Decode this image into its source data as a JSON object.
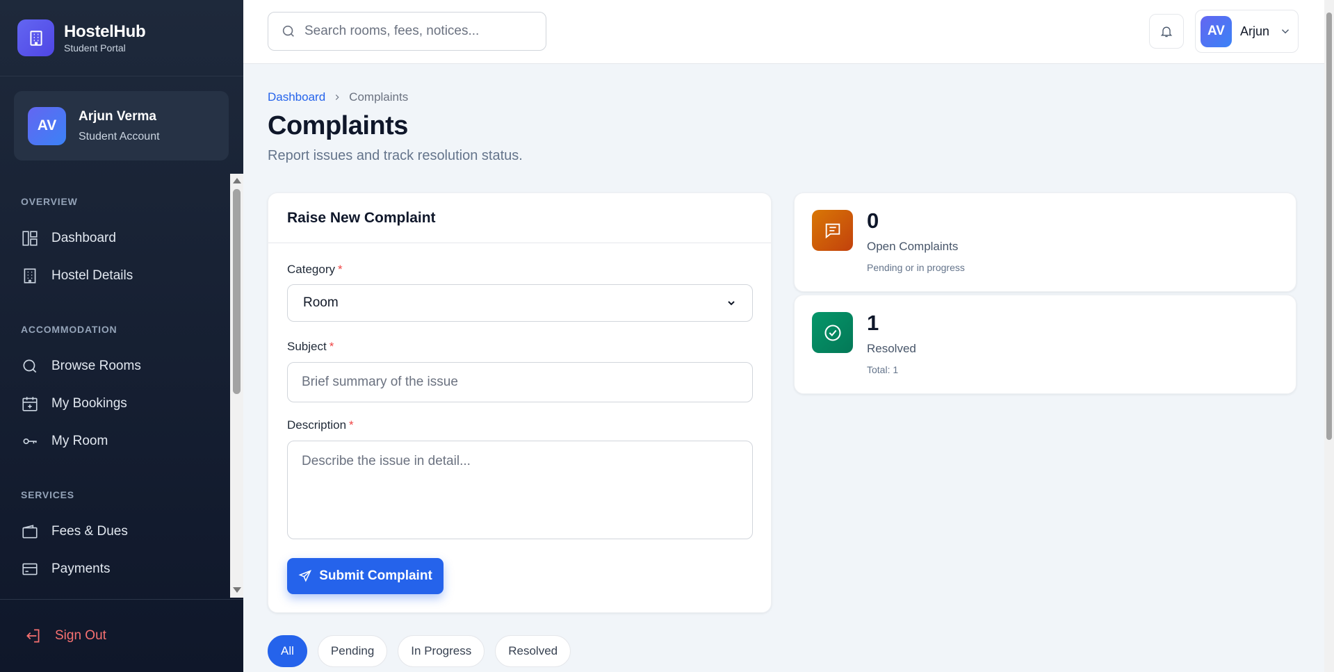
{
  "brand": {
    "name": "HostelHub",
    "subtitle": "Student Portal"
  },
  "user": {
    "initials": "AV",
    "name": "Arjun Verma",
    "role": "Student Account",
    "short_name": "Arjun"
  },
  "nav": {
    "sections": [
      {
        "title": "OVERVIEW",
        "items": [
          {
            "label": "Dashboard",
            "icon": "dashboard-icon"
          },
          {
            "label": "Hostel Details",
            "icon": "building-icon"
          }
        ]
      },
      {
        "title": "ACCOMMODATION",
        "items": [
          {
            "label": "Browse Rooms",
            "icon": "search-icon"
          },
          {
            "label": "My Bookings",
            "icon": "calendar-plus-icon"
          },
          {
            "label": "My Room",
            "icon": "key-icon"
          }
        ]
      },
      {
        "title": "SERVICES",
        "items": [
          {
            "label": "Fees & Dues",
            "icon": "wallet-icon"
          },
          {
            "label": "Payments",
            "icon": "credit-card-icon"
          }
        ]
      }
    ],
    "sign_out": "Sign Out"
  },
  "search": {
    "placeholder": "Search rooms, fees, notices..."
  },
  "breadcrumb": {
    "root": "Dashboard",
    "current": "Complaints"
  },
  "page": {
    "title": "Complaints",
    "subtitle": "Report issues and track resolution status."
  },
  "form": {
    "title": "Raise New Complaint",
    "category_label": "Category",
    "category_value": "Room",
    "subject_label": "Subject",
    "subject_placeholder": "Brief summary of the issue",
    "description_label": "Description",
    "description_placeholder": "Describe the issue in detail...",
    "required_mark": "*",
    "submit_label": "Submit Complaint"
  },
  "stats": [
    {
      "value": "0",
      "label": "Open Complaints",
      "sub": "Pending or in progress",
      "color": "#d97706"
    },
    {
      "value": "1",
      "label": "Resolved",
      "sub": "Total: 1",
      "color": "#059669"
    }
  ],
  "filters": [
    "All",
    "Pending",
    "In Progress",
    "Resolved"
  ],
  "colors": {
    "accent": "#2563eb",
    "sidebar": "#1e293b",
    "danger": "#ef4444"
  }
}
